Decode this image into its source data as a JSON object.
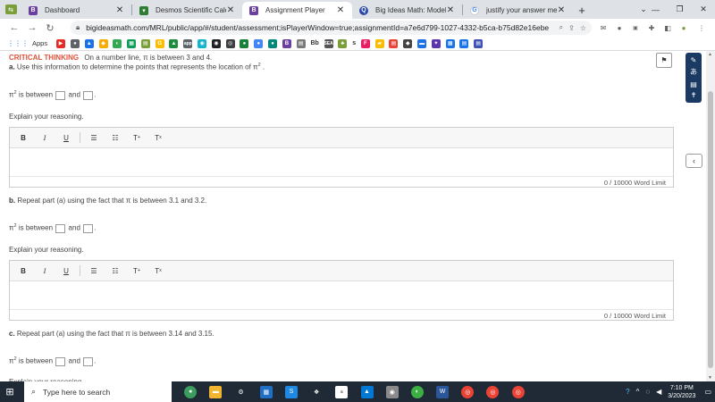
{
  "browser": {
    "tabs": [
      {
        "title": "Dashboard",
        "favicon_color": "#6b3fa0",
        "favicon_letter": "B",
        "active": false
      },
      {
        "title": "Desmos Scientific Calculator",
        "favicon_color": "#2e7d32",
        "favicon_letter": "",
        "active": false
      },
      {
        "title": "Assignment Player",
        "favicon_color": "#6b3fa0",
        "favicon_letter": "B",
        "active": true
      },
      {
        "title": "Big Ideas Math: Modeling Real Life",
        "favicon_color": "#2a4aa8",
        "favicon_letter": "Q",
        "active": false
      },
      {
        "title": "justify your answer meaning",
        "favicon_color": "#ea4335",
        "favicon_letter": "G",
        "active": false
      }
    ],
    "url": "bigideasmath.com/MRL/public/app/#/student/assessment;isPlayerWindow=true;assignmentId=a7e6d799-1027-4332-b5ca-b75d82e16ebe",
    "bookmarks_label": "Apps",
    "bookmark_text_bb": "Bb",
    "bookmark_text_s": "s"
  },
  "question": {
    "critical_label": "CRITICAL THINKING",
    "intro": "On a number line, π is between 3 and 4.",
    "part_a_label": "a.",
    "part_a_text": "Use this information to determine the points that represents the location of π",
    "pi_squared": "π",
    "is_between": "is between",
    "and_label": "and",
    "explain": "Explain your reasoning.",
    "part_b_label": "b.",
    "part_b_text": "Repeat part (a) using the fact that π  is between 3.1 and 3.2.",
    "part_c_label": "c.",
    "part_c_text": "Repeat part (a) using the fact that π  is between 3.14 and 3.15.",
    "word_limit": "0 / 10000 Word Limit"
  },
  "editor_toolbar": {
    "bold": "B",
    "italic": "I",
    "underline": "U",
    "bullet_list": "☰",
    "numbered_list": "☷",
    "superscript": "T",
    "subscript": "T"
  },
  "taskbar": {
    "search_placeholder": "Type here to search",
    "time": "7:10 PM",
    "date": "3/20/2023"
  }
}
